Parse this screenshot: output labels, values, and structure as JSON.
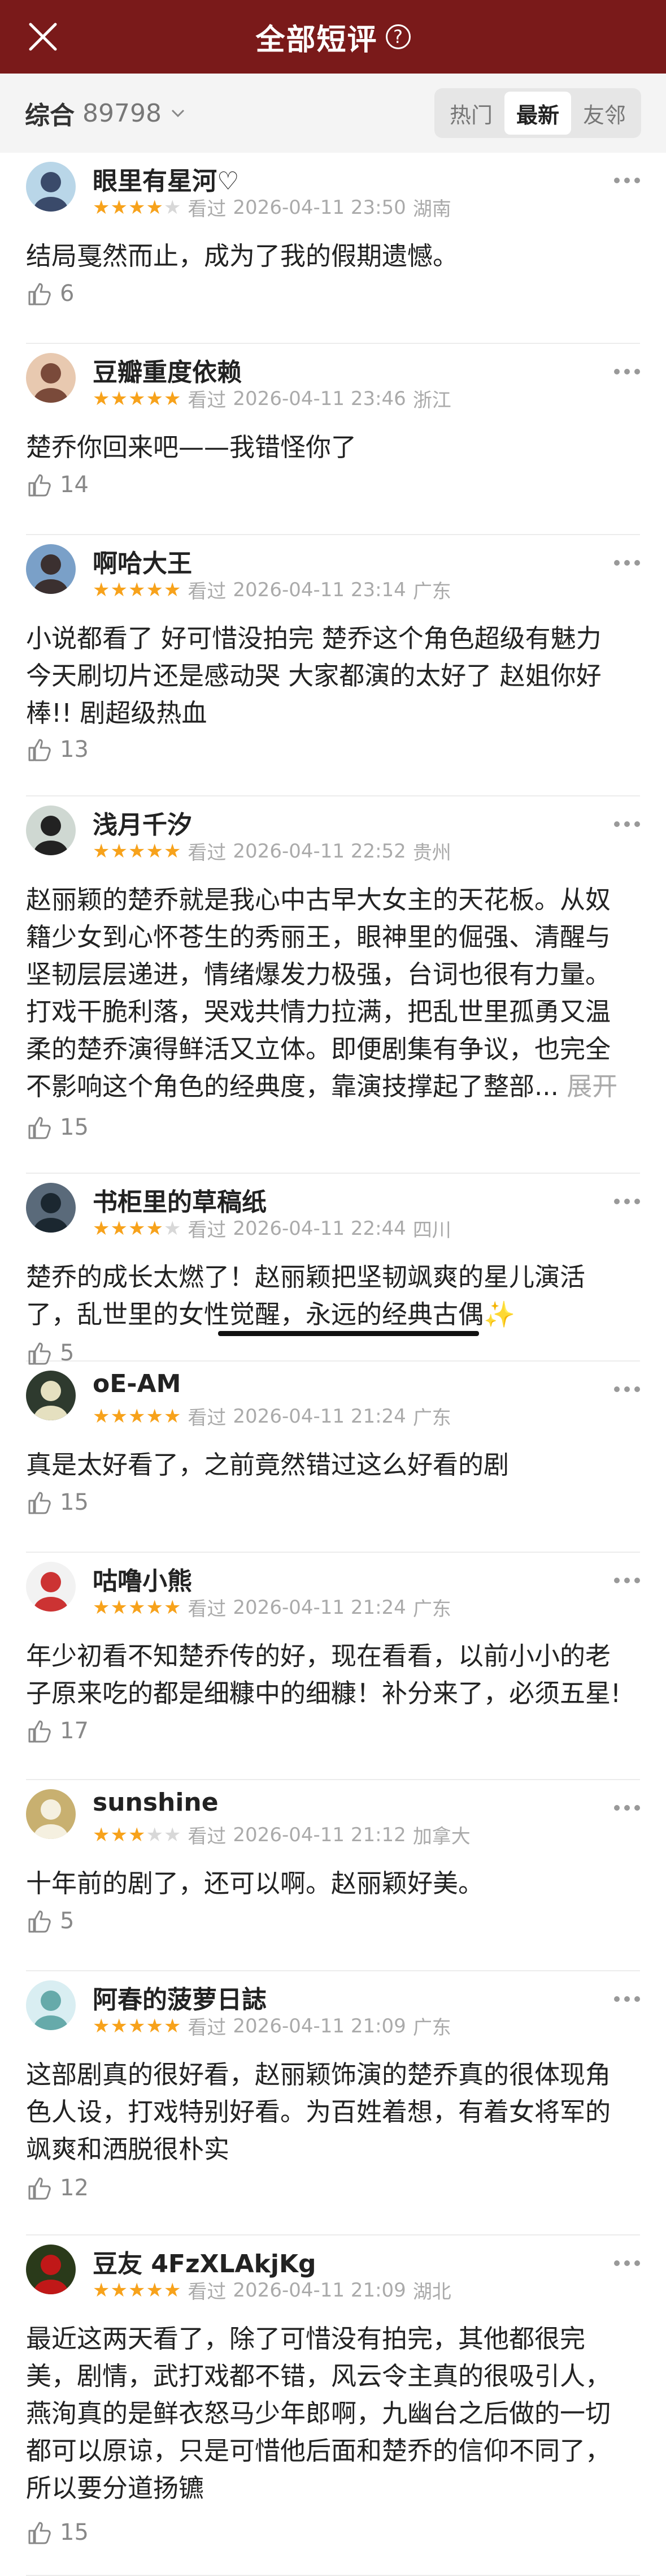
{
  "header": {
    "title": "全部短评",
    "help": "?"
  },
  "filter": {
    "label": "综合",
    "count": "89798",
    "tabs": [
      "热门",
      "最新",
      "友邻"
    ],
    "active_tab": 1
  },
  "colors": {
    "header": "#7a1a1a",
    "star": "#f7a21b"
  },
  "reviews": [
    {
      "name": "眼里有星河♡",
      "stars": 4,
      "watched": "看过",
      "time": "2026-04-11 23:50",
      "location": "湖南",
      "lines": [
        "结局戛然而止，成为了我的假期遗憾。"
      ],
      "likes": "6"
    },
    {
      "name": "豆瓣重度依赖",
      "stars": 5,
      "watched": "看过",
      "time": "2026-04-11 23:46",
      "location": "浙江",
      "lines": [
        "楚乔你回来吧——我错怪你了"
      ],
      "likes": "14"
    },
    {
      "name": "啊哈大王",
      "stars": 5,
      "watched": "看过",
      "time": "2026-04-11 23:14",
      "location": "广东",
      "lines": [
        "小说都看了 好可惜没拍完 楚乔这个角色超级有魅力",
        "今天刷切片还是感动哭 大家都演的太好了 赵姐你好",
        "棒!! 剧超级热血"
      ],
      "likes": "13"
    },
    {
      "name": "浅月千汐",
      "stars": 5,
      "watched": "看过",
      "time": "2026-04-11 22:52",
      "location": "贵州",
      "lines": [
        "赵丽颖的楚乔就是我心中古早大女主的天花板。从奴",
        "籍少女到心怀苍生的秀丽王，眼神里的倔强、清醒与",
        "坚韧层层递进，情绪爆发力极强，台词也很有力量。",
        "打戏干脆利落，哭戏共情力拉满，把乱世里孤勇又温",
        "柔的楚乔演得鲜活又立体。即便剧集有争议，也完全",
        "不影响这个角色的经典度，靠演技撑起了整部..."
      ],
      "expand": "展开",
      "likes": "15"
    },
    {
      "name": "书柜里的草稿纸",
      "stars": 4,
      "watched": "看过",
      "time": "2026-04-11 22:44",
      "location": "四川",
      "lines": [
        "楚乔的成长太燃了！赵丽颖把坚韧飒爽的星儿演活",
        "了，乱世里的女性觉醒，永远的经典古偶✨"
      ],
      "likes": "5"
    },
    {
      "name": "oE-AM",
      "stars": 5,
      "watched": "看过",
      "time": "2026-04-11 21:24",
      "location": "广东",
      "lines": [
        "真是太好看了，之前竟然错过这么好看的剧"
      ],
      "likes": "15"
    },
    {
      "name": "咕噜小熊",
      "stars": 5,
      "watched": "看过",
      "time": "2026-04-11 21:24",
      "location": "广东",
      "lines": [
        "年少初看不知楚乔传的好，现在看看，以前小小的老",
        "子原来吃的都是细糠中的细糠！补分来了，必须五星!"
      ],
      "likes": "17"
    },
    {
      "name": "sunshine",
      "stars": 3,
      "watched": "看过",
      "time": "2026-04-11 21:12",
      "location": "加拿大",
      "lines": [
        "十年前的剧了，还可以啊。赵丽颖好美。"
      ],
      "likes": "5"
    },
    {
      "name": "阿春的菠萝日誌",
      "stars": 5,
      "watched": "看过",
      "time": "2026-04-11 21:09",
      "location": "广东",
      "lines": [
        "这部剧真的很好看，赵丽颖饰演的楚乔真的很体现角",
        "色人设，打戏特别好看。为百姓着想，有着女将军的",
        "飒爽和洒脱很朴实"
      ],
      "likes": "12"
    },
    {
      "name": "豆友 4FzXLAkjKg",
      "stars": 5,
      "watched": "看过",
      "time": "2026-04-11 21:09",
      "location": "湖北",
      "lines": [
        "最近这两天看了，除了可惜没有拍完，其他都很完",
        "美，剧情，武打戏都不错，风云令主真的很吸引人，",
        "燕洵真的是鲜衣怒马少年郎啊，九幽台之后做的一切",
        "都可以原谅，只是可惜他后面和楚乔的信仰不同了，",
        "所以要分道扬镳"
      ],
      "likes": "15"
    }
  ]
}
